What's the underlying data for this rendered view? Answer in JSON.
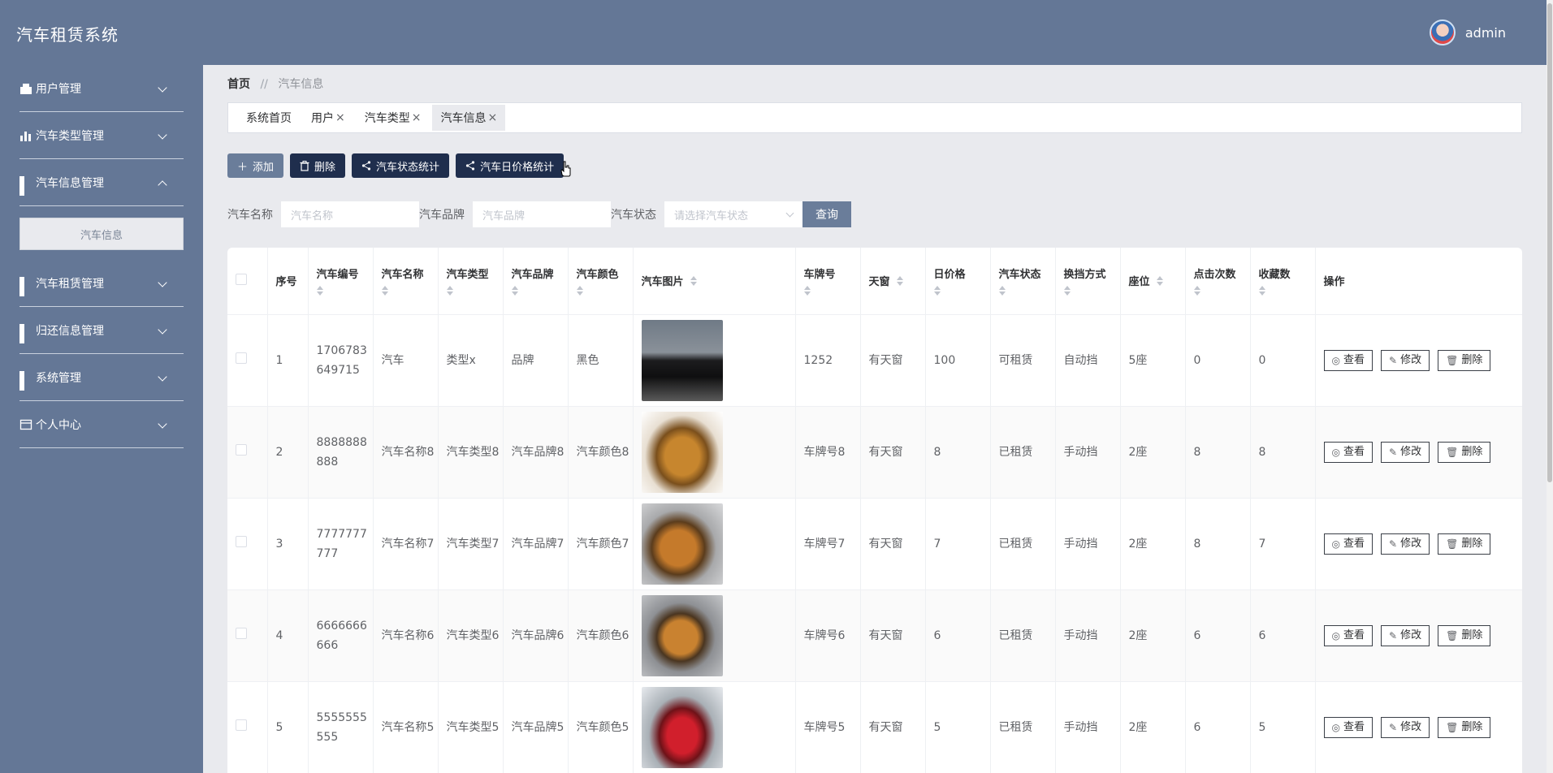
{
  "header": {
    "app_title": "汽车租赁系统",
    "username": "admin"
  },
  "sidebar": {
    "items": [
      {
        "label": "用户管理",
        "icon": "user-icon"
      },
      {
        "label": "汽车类型管理",
        "icon": "bar-chart-icon"
      },
      {
        "label": "汽车信息管理",
        "icon": "grid-icon",
        "expanded": true,
        "sub": "汽车信息"
      },
      {
        "label": "汽车租赁管理",
        "icon": "grid-icon"
      },
      {
        "label": "归还信息管理",
        "icon": "grid-icon"
      },
      {
        "label": "系统管理",
        "icon": "grid-icon"
      },
      {
        "label": "个人中心",
        "icon": "id-card-icon"
      }
    ]
  },
  "breadcrumb": {
    "home": "首页",
    "separator": "//",
    "current": "汽车信息"
  },
  "tabs": [
    {
      "label": "系统首页"
    },
    {
      "label": "用户",
      "close": "×"
    },
    {
      "label": "汽车类型",
      "close": "×"
    },
    {
      "label": "汽车信息",
      "close": "×"
    }
  ],
  "toolbar": {
    "add": "添加",
    "delete": "删除",
    "status_stats": "汽车状态统计",
    "price_stats": "汽车日价格统计"
  },
  "search": {
    "name_label": "汽车名称",
    "name_placeholder": "汽车名称",
    "brand_label": "汽车品牌",
    "brand_placeholder": "汽车品牌",
    "status_label": "汽车状态",
    "status_placeholder": "请选择汽车状态",
    "query": "查询"
  },
  "table": {
    "columns": [
      "序号",
      "汽车编号",
      "汽车名称",
      "汽车类型",
      "汽车品牌",
      "汽车颜色",
      "汽车图片",
      "车牌号",
      "天窗",
      "日价格",
      "汽车状态",
      "换挡方式",
      "座位",
      "点击次数",
      "收藏数",
      "操作"
    ],
    "actions": {
      "view": "查看",
      "edit": "修改",
      "delete": "删除"
    },
    "rows": [
      {
        "idx": "1",
        "code": "1706783649715",
        "name": "汽车",
        "type": "类型x",
        "brand": "品牌",
        "color": "黑色",
        "plate": "1252",
        "sunroof": "有天窗",
        "price": "100",
        "status": "可租赁",
        "gear": "自动挡",
        "seats": "5座",
        "clicks": "0",
        "favs": "0"
      },
      {
        "idx": "2",
        "code": "8888888888",
        "name": "汽车名称8",
        "type": "汽车类型8",
        "brand": "汽车品牌8",
        "color": "汽车颜色8",
        "plate": "车牌号8",
        "sunroof": "有天窗",
        "price": "8",
        "status": "已租赁",
        "gear": "手动挡",
        "seats": "2座",
        "clicks": "8",
        "favs": "8"
      },
      {
        "idx": "3",
        "code": "7777777777",
        "name": "汽车名称7",
        "type": "汽车类型7",
        "brand": "汽车品牌7",
        "color": "汽车颜色7",
        "plate": "车牌号7",
        "sunroof": "有天窗",
        "price": "7",
        "status": "已租赁",
        "gear": "手动挡",
        "seats": "2座",
        "clicks": "8",
        "favs": "7"
      },
      {
        "idx": "4",
        "code": "6666666666",
        "name": "汽车名称6",
        "type": "汽车类型6",
        "brand": "汽车品牌6",
        "color": "汽车颜色6",
        "plate": "车牌号6",
        "sunroof": "有天窗",
        "price": "6",
        "status": "已租赁",
        "gear": "手动挡",
        "seats": "2座",
        "clicks": "6",
        "favs": "6"
      },
      {
        "idx": "5",
        "code": "5555555555",
        "name": "汽车名称5",
        "type": "汽车类型5",
        "brand": "汽车品牌5",
        "color": "汽车颜色5",
        "plate": "车牌号5",
        "sunroof": "有天窗",
        "price": "5",
        "status": "已租赁",
        "gear": "手动挡",
        "seats": "2座",
        "clicks": "6",
        "favs": "5"
      }
    ]
  }
}
